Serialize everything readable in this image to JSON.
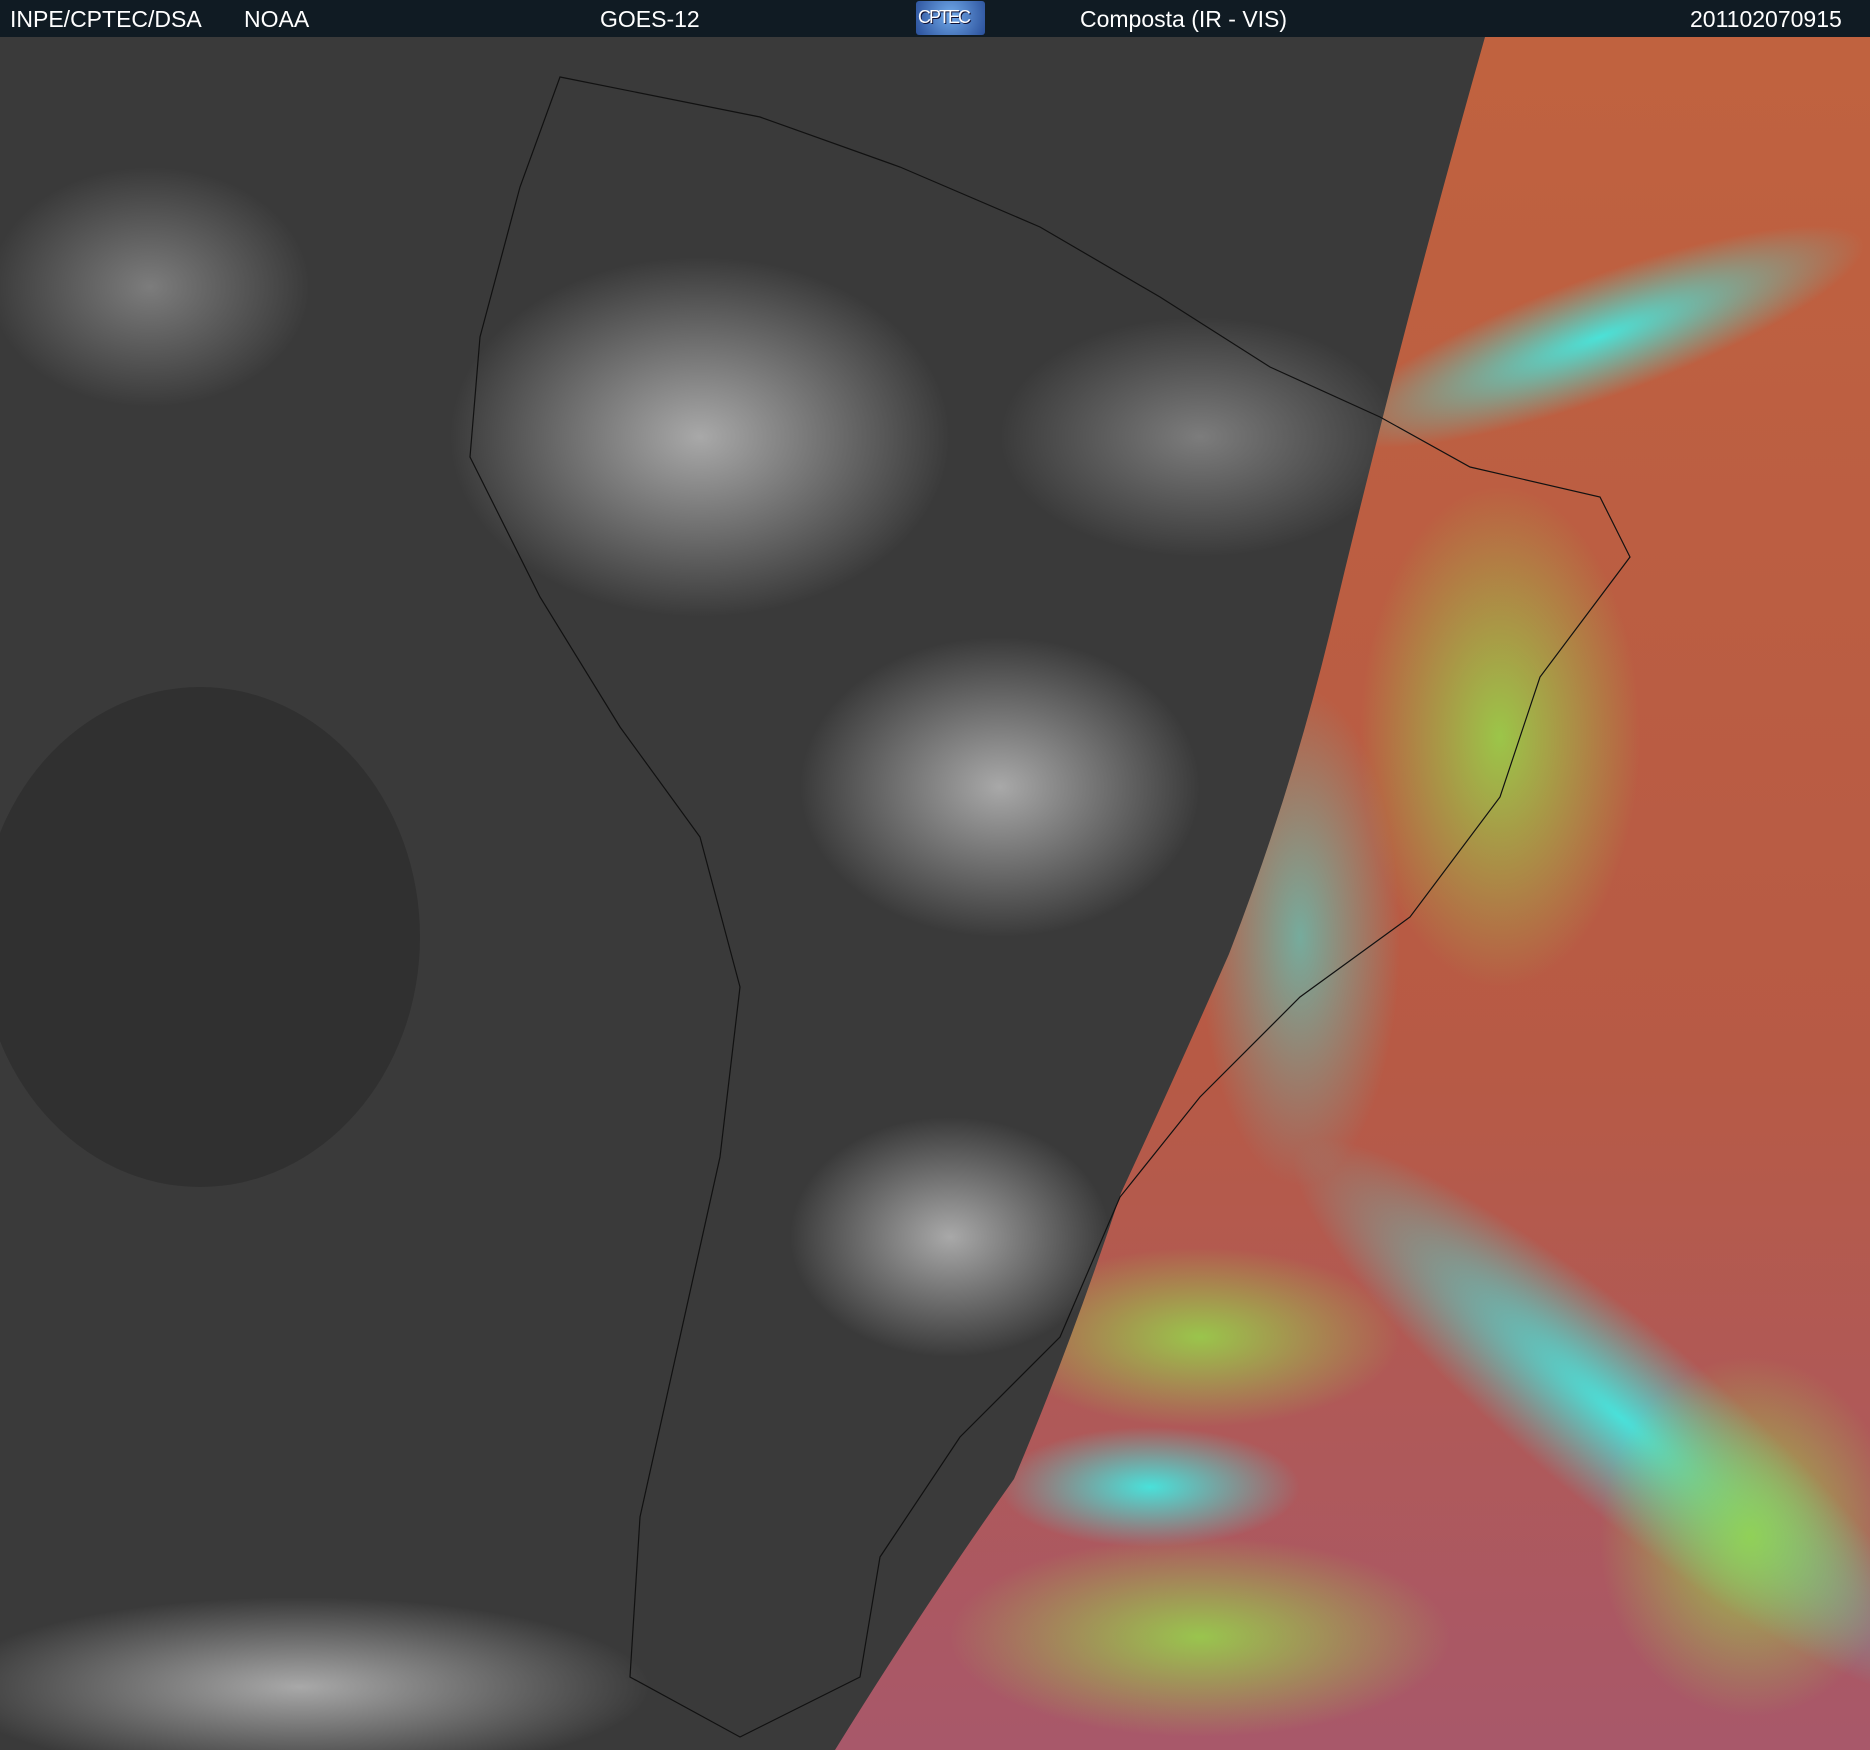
{
  "header": {
    "institution": "INPE/CPTEC/DSA",
    "agency": "NOAA",
    "satellite": "GOES-12",
    "logo_text": "CPTEC",
    "product": "Composta (IR - VIS)",
    "timestamp": "201102070915"
  },
  "colors": {
    "header_bg": "#101b23",
    "ir_gray": "#3a3a3a",
    "vis_red": "#b85a40",
    "vis_green": "#8fd24a",
    "vis_cyan": "#3ef0e0"
  }
}
